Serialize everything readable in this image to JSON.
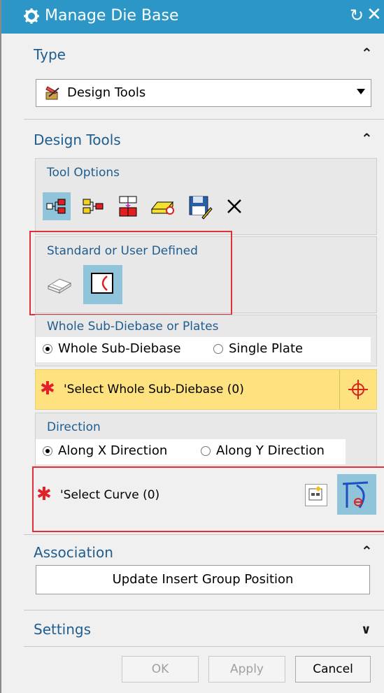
{
  "titlebar": {
    "title": "Manage Die Base",
    "icons": [
      "gear-icon",
      "reset-icon",
      "close-icon"
    ]
  },
  "type_section": {
    "label": "Type",
    "combo_value": "Design Tools",
    "combo_icon": "design-tools-icon"
  },
  "design_tools_section": {
    "label": "Design Tools",
    "tool_options_label": "Tool Options",
    "tool_icons": [
      "tree-structure-icon",
      "branch-icon",
      "stack-icon",
      "eraser-icon",
      "save-icon",
      "delete-icon"
    ],
    "standard_label": "Standard or User Defined",
    "standard_icons": [
      "plate-icon",
      "user-defined-icon"
    ],
    "whole_label": "Whole Sub-Diebase or Plates",
    "whole_option": "Whole Sub-Diebase",
    "single_option": "Single Plate",
    "select_whole": "'Select Whole Sub-Diebase (0)",
    "direction_label": "Direction",
    "along_x": "Along X Direction",
    "along_y": "Along Y Direction",
    "select_curve": "'Select Curve (0)"
  },
  "association_section": {
    "label": "Association",
    "update_button": "Update Insert Group Position"
  },
  "settings_section": {
    "label": "Settings"
  },
  "footer": {
    "ok": "OK",
    "apply": "Apply",
    "cancel": "Cancel"
  },
  "colors": {
    "titlebar": "#2c97c6",
    "section_label": "#1f5d8f",
    "selection_bar": "#fde27f",
    "highlight_box": "#e0303a",
    "selected_button": "#8fc4da"
  }
}
